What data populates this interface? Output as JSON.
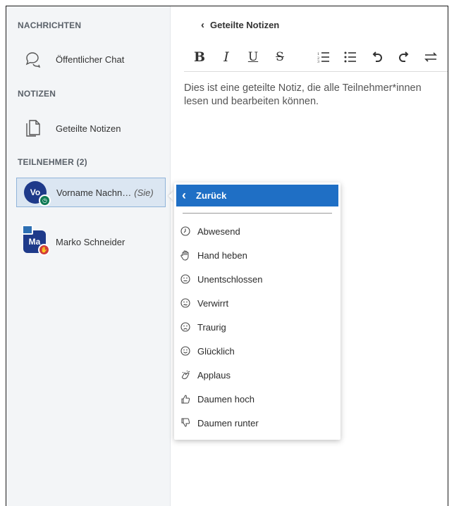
{
  "sidebar": {
    "messages_title": "NACHRICHTEN",
    "public_chat": "Öffentlicher Chat",
    "notes_title": "NOTIZEN",
    "shared_notes": "Geteilte Notizen",
    "participants_title": "TEILNEHMER (2)",
    "users": [
      {
        "initials": "Vo",
        "name": "Vorname Nachn…",
        "you_tag": "(Sie)",
        "avatar_color": "#1e3a8a",
        "status_color": "#0f7a55"
      },
      {
        "initials": "Ma",
        "name": "Marko Schneider",
        "avatar_color": "#1e3a8a",
        "status_color": "#d13b3b"
      }
    ]
  },
  "main": {
    "back_label": "Geteilte Notizen",
    "toolbar": {
      "bold": "B",
      "italic": "I",
      "underline": "U",
      "strike": "S"
    },
    "note_text": "Dies ist eine geteilte Notiz, die alle Teilnehmer*innen lesen und bearbeiten können."
  },
  "status_menu": {
    "back_label": "Zurück",
    "accent": "#1f6fc5",
    "items": [
      {
        "label": "Abwesend",
        "icon": "clock-icon"
      },
      {
        "label": "Hand heben",
        "icon": "hand-icon"
      },
      {
        "label": "Unentschlossen",
        "icon": "neutral-face-icon"
      },
      {
        "label": "Verwirrt",
        "icon": "confused-face-icon"
      },
      {
        "label": "Traurig",
        "icon": "sad-face-icon"
      },
      {
        "label": "Glücklich",
        "icon": "happy-face-icon"
      },
      {
        "label": "Applaus",
        "icon": "applause-icon"
      },
      {
        "label": "Daumen hoch",
        "icon": "thumbs-up-icon"
      },
      {
        "label": "Daumen runter",
        "icon": "thumbs-down-icon"
      }
    ]
  }
}
